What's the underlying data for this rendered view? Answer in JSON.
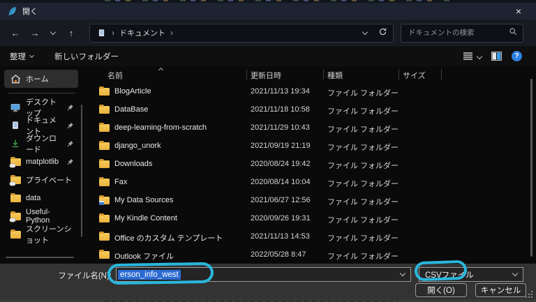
{
  "window": {
    "title": "開く",
    "close_glyph": "×"
  },
  "nav": {
    "back_glyph": "←",
    "forward_glyph": "→",
    "up_glyph": "↑"
  },
  "address": {
    "location": "ドキュメント",
    "separator": "›"
  },
  "search": {
    "placeholder": "ドキュメントの検索"
  },
  "toolbar": {
    "organize": "整理",
    "new_folder": "新しいフォルダー",
    "help_glyph": "?"
  },
  "sidebar": {
    "items": [
      {
        "label": "ホーム",
        "icon": "home-icon",
        "pinned": false,
        "selected": true
      },
      {
        "label": "デスクトップ",
        "icon": "desktop-icon",
        "pinned": true
      },
      {
        "label": "ドキュメント",
        "icon": "document-icon",
        "pinned": true
      },
      {
        "label": "ダウンロード",
        "icon": "download-icon",
        "pinned": true
      },
      {
        "label": "matplotlib",
        "icon": "folder-cloud-icon",
        "pinned": true
      },
      {
        "label": "プライベート",
        "icon": "folder-cloud-icon",
        "pinned": false
      },
      {
        "label": "data",
        "icon": "folder-icon",
        "pinned": false
      },
      {
        "label": "Useful-Python",
        "icon": "folder-cloud-icon",
        "pinned": false
      },
      {
        "label": "スクリーンショット",
        "icon": "folder-icon",
        "pinned": false
      }
    ]
  },
  "files": {
    "columns": [
      "名前",
      "更新日時",
      "種類",
      "サイズ"
    ],
    "rows": [
      {
        "name": "BlogArticle",
        "date": "2021/11/13 19:34",
        "type": "ファイル フォルダー",
        "size": ""
      },
      {
        "name": "DataBase",
        "date": "2021/11/18 10:58",
        "type": "ファイル フォルダー",
        "size": ""
      },
      {
        "name": "deep-learning-from-scratch",
        "date": "2021/11/29 10:43",
        "type": "ファイル フォルダー",
        "size": ""
      },
      {
        "name": "django_unork",
        "date": "2021/09/19 21:19",
        "type": "ファイル フォルダー",
        "size": ""
      },
      {
        "name": "Downloads",
        "date": "2020/08/24 19:42",
        "type": "ファイル フォルダー",
        "size": ""
      },
      {
        "name": "Fax",
        "date": "2020/08/14 10:04",
        "type": "ファイル フォルダー",
        "size": ""
      },
      {
        "name": "My Data Sources",
        "date": "2021/06/27 12:56",
        "type": "ファイル フォルダー",
        "size": ""
      },
      {
        "name": "My Kindle Content",
        "date": "2020/09/26 19:31",
        "type": "ファイル フォルダー",
        "size": ""
      },
      {
        "name": "Office のカスタム テンプレート",
        "date": "2021/11/13 14:53",
        "type": "ファイル フォルダー",
        "size": ""
      },
      {
        "name": "Outlook ファイル",
        "date": "2022/05/28 8:47",
        "type": "ファイル フォルダー",
        "size": ""
      }
    ]
  },
  "footer": {
    "filename_label": "ファイル名(N):",
    "filename_value": "erson_info_west",
    "filetype_value": "CSVファイル",
    "open_label": "開く(O)",
    "cancel_label": "キャンセル"
  },
  "colors": {
    "annotation": "#29b7dd",
    "selection_blue": "#2b6bd3",
    "folder_yellow": "#f3c04b"
  }
}
